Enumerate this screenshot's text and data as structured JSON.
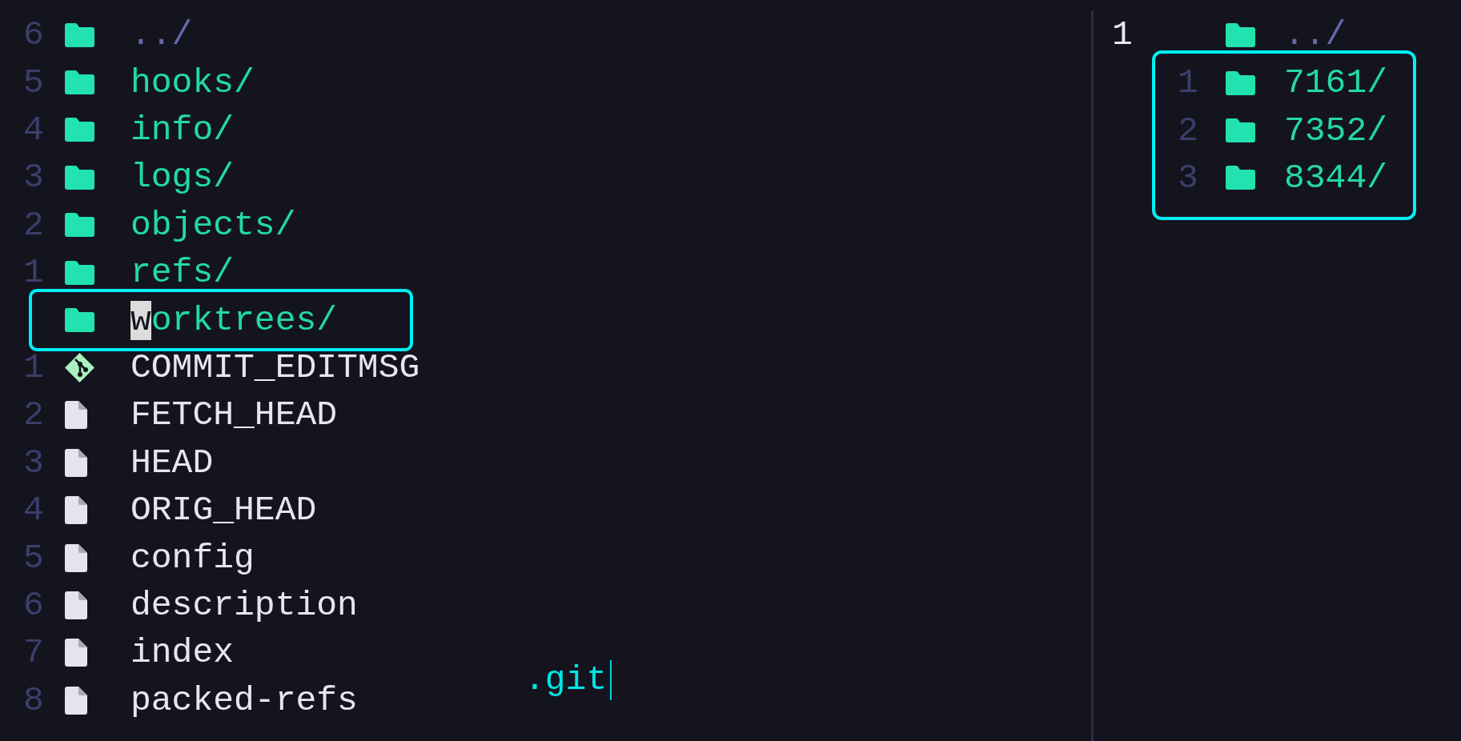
{
  "left_pane": {
    "rows": [
      {
        "line_number": "6",
        "kind": "parent",
        "name": "../",
        "current": false
      },
      {
        "line_number": "5",
        "kind": "directory",
        "name": "hooks/",
        "current": false
      },
      {
        "line_number": "4",
        "kind": "directory",
        "name": "info/",
        "current": false
      },
      {
        "line_number": "3",
        "kind": "directory",
        "name": "logs/",
        "current": false
      },
      {
        "line_number": "2",
        "kind": "directory",
        "name": "objects/",
        "current": false
      },
      {
        "line_number": "1",
        "kind": "directory",
        "name": "refs/",
        "current": false
      },
      {
        "kind": "directory",
        "name": "worktrees/",
        "current": true
      },
      {
        "line_number": "1",
        "kind": "git",
        "name": "COMMIT_EDITMSG",
        "current": false
      },
      {
        "line_number": "2",
        "kind": "file",
        "name": "FETCH_HEAD",
        "current": false
      },
      {
        "line_number": "3",
        "kind": "file",
        "name": "HEAD",
        "current": false
      },
      {
        "line_number": "4",
        "kind": "file",
        "name": "ORIG_HEAD",
        "current": false
      },
      {
        "line_number": "5",
        "kind": "file",
        "name": "config",
        "current": false
      },
      {
        "line_number": "6",
        "kind": "file",
        "name": "description",
        "current": false
      },
      {
        "line_number": "7",
        "kind": "file",
        "name": "index",
        "current": false
      },
      {
        "line_number": "8",
        "kind": "file",
        "name": "packed-refs",
        "current": false
      }
    ],
    "input": {
      "value": ".git"
    }
  },
  "right_pane": {
    "rows": [
      {
        "line_number": "1",
        "kind": "parent",
        "name": "../",
        "active_line": true
      }
    ],
    "preview": {
      "rows": [
        {
          "line_number": "1",
          "kind": "directory",
          "name": "7161/"
        },
        {
          "line_number": "2",
          "kind": "directory",
          "name": "7352/"
        },
        {
          "line_number": "3",
          "kind": "directory",
          "name": "8344/"
        }
      ]
    }
  }
}
